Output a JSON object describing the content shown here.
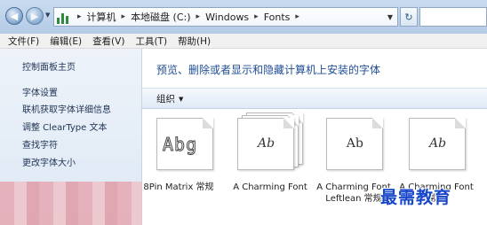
{
  "breadcrumbs": [
    "计算机",
    "本地磁盘 (C:)",
    "Windows",
    "Fonts"
  ],
  "menu": [
    "文件(F)",
    "编辑(E)",
    "查看(V)",
    "工具(T)",
    "帮助(H)"
  ],
  "sidebar": {
    "home": "控制面板主页",
    "links": [
      "字体设置",
      "联机获取字体详细信息",
      "调整 ClearType 文本",
      "查找字符",
      "更改字体大小"
    ]
  },
  "main": {
    "headline": "预览、删除或者显示和隐藏计算机上安装的字体",
    "organize_label": "组织",
    "fonts": [
      {
        "name": "8Pin Matrix 常规",
        "sample": "Abg"
      },
      {
        "name": "A Charming Font",
        "sample": "Ab"
      },
      {
        "name": "A Charming Font Leftlean 常规",
        "sample": "Ab"
      },
      {
        "name": "A Charming Font 常规",
        "sample": "Ab"
      }
    ]
  },
  "watermark": "最需教育",
  "icons": {
    "back": "arrow-left",
    "forward": "arrow-right",
    "refresh": "refresh",
    "fonts_folder": "fonts-folder"
  }
}
